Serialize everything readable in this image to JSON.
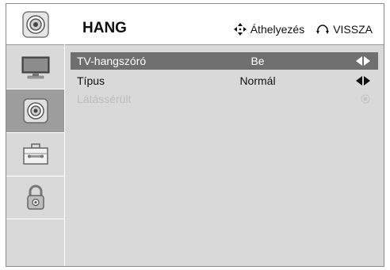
{
  "header": {
    "title": "HANG",
    "move_hint": "Áthelyezés",
    "back_hint": "VISSZA"
  },
  "sidebar": {
    "items": [
      {
        "icon": "speaker-icon",
        "selected": false
      },
      {
        "icon": "tv-screen-icon",
        "selected": false
      },
      {
        "icon": "speaker-icon",
        "selected": true
      },
      {
        "icon": "toolbox-icon",
        "selected": false
      },
      {
        "icon": "lock-icon",
        "selected": false
      }
    ]
  },
  "menu": {
    "rows": [
      {
        "label": "TV-hangszóró",
        "value": "Be",
        "control": "left-right-arrows",
        "highlighted": true
      },
      {
        "label": "Típus",
        "value": "Normál",
        "control": "left-right-arrows",
        "highlighted": false
      },
      {
        "label": "Látássérült",
        "value": "",
        "control": "radio",
        "disabled": true
      }
    ]
  },
  "colors": {
    "sidebar_bg": "#d9d9d9",
    "sidebar_selected": "#9d9d9d",
    "row_highlight": "#6f6f6f",
    "disabled_text": "#bdbdbd"
  }
}
